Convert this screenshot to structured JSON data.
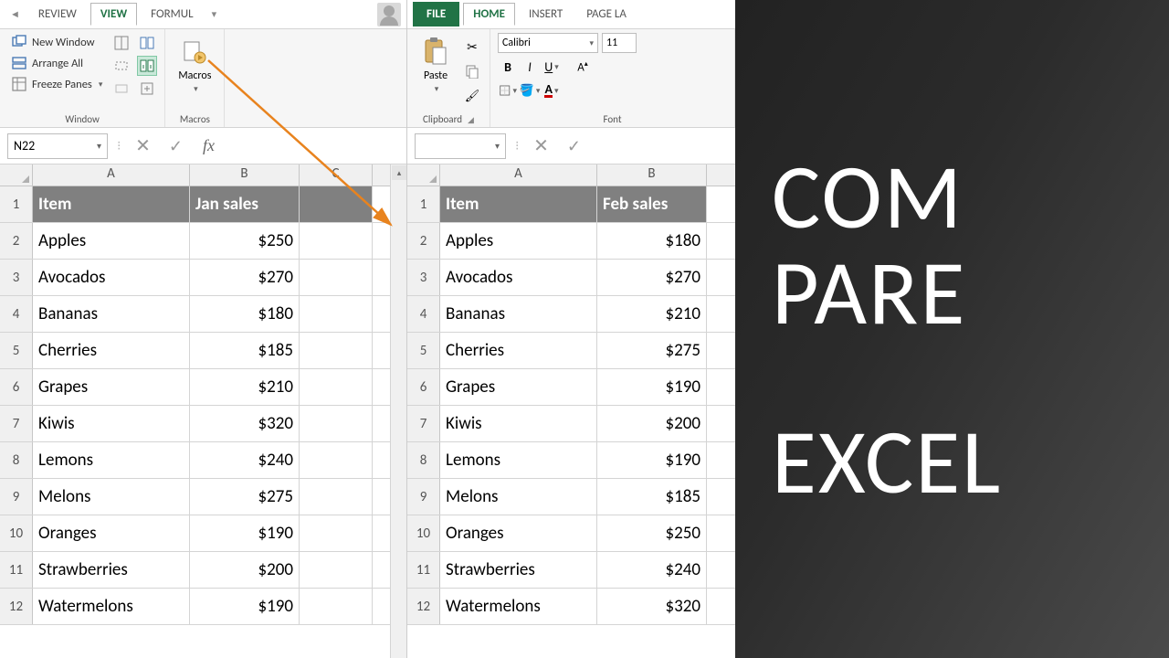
{
  "right_panel": {
    "line1": "COM",
    "line2": "PARE",
    "line3": "EXCEL"
  },
  "left": {
    "tabs": {
      "review": "REVIEW",
      "view": "VIEW",
      "formul": "FORMUL"
    },
    "ribbon": {
      "new_window": "New Window",
      "arrange_all": "Arrange All",
      "freeze_panes": "Freeze Panes",
      "macros": "Macros",
      "group_window": "Window",
      "group_macros": "Macros"
    },
    "namebox": "N22",
    "headers": {
      "item": "Item",
      "sales": "Jan sales"
    },
    "rows": [
      {
        "item": "Apples",
        "val": "$250"
      },
      {
        "item": "Avocados",
        "val": "$270"
      },
      {
        "item": "Bananas",
        "val": "$180"
      },
      {
        "item": "Cherries",
        "val": "$185"
      },
      {
        "item": "Grapes",
        "val": "$210"
      },
      {
        "item": "Kiwis",
        "val": "$320"
      },
      {
        "item": "Lemons",
        "val": "$240"
      },
      {
        "item": "Melons",
        "val": "$275"
      },
      {
        "item": "Oranges",
        "val": "$190"
      },
      {
        "item": "Strawberries",
        "val": "$200"
      },
      {
        "item": "Watermelons",
        "val": "$190"
      }
    ]
  },
  "right": {
    "tabs": {
      "file": "FILE",
      "home": "HOME",
      "insert": "INSERT",
      "pagela": "PAGE LA"
    },
    "ribbon": {
      "paste": "Paste",
      "group_clipboard": "Clipboard",
      "group_font": "Font",
      "font_name": "Calibri",
      "font_size": "11"
    },
    "headers": {
      "item": "Item",
      "sales": "Feb sales"
    },
    "rows": [
      {
        "item": "Apples",
        "val": "$180"
      },
      {
        "item": "Avocados",
        "val": "$270"
      },
      {
        "item": "Bananas",
        "val": "$210"
      },
      {
        "item": "Cherries",
        "val": "$275"
      },
      {
        "item": "Grapes",
        "val": "$190"
      },
      {
        "item": "Kiwis",
        "val": "$200"
      },
      {
        "item": "Lemons",
        "val": "$190"
      },
      {
        "item": "Melons",
        "val": "$185"
      },
      {
        "item": "Oranges",
        "val": "$250"
      },
      {
        "item": "Strawberries",
        "val": "$240"
      },
      {
        "item": "Watermelons",
        "val": "$320"
      }
    ]
  },
  "fx": "fx"
}
